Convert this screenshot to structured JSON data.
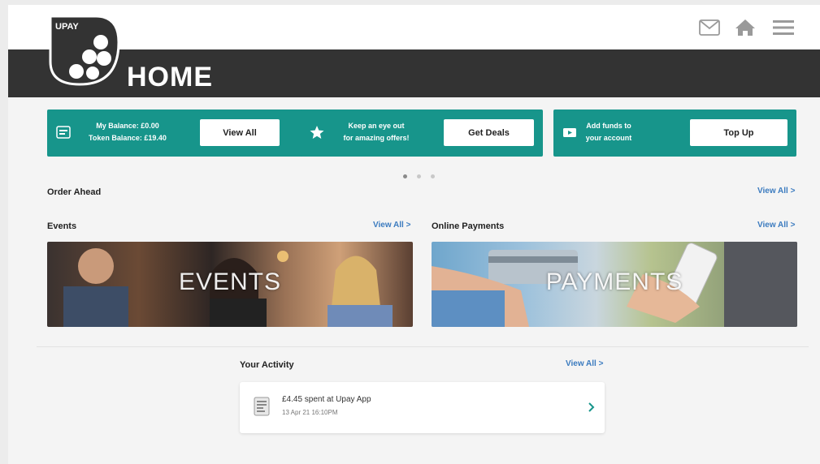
{
  "header": {
    "logo_text": "UPAY",
    "title": "HOME",
    "icons": [
      "mail-icon",
      "home-icon",
      "menu-icon"
    ]
  },
  "banners": [
    {
      "icon": "wallet-icon",
      "lines": [
        "My Balance: £0.00",
        "Token Balance: £19.40"
      ],
      "button": "View All"
    },
    {
      "icon": "star-icon",
      "lines": [
        "Keep an eye out",
        "for amazing offers!"
      ],
      "button": "Get Deals"
    },
    {
      "icon": "card-icon",
      "lines": [
        "Add funds to",
        "your account"
      ],
      "button": "Top Up"
    }
  ],
  "carousel": {
    "count": 3,
    "active_index": 0
  },
  "order_ahead": {
    "title": "Order Ahead",
    "view_all": "View All >"
  },
  "events": {
    "title": "Events",
    "view_all": "View All >",
    "image_label": "EVENTS"
  },
  "online_payments": {
    "title": "Online Payments",
    "view_all": "View All >",
    "image_label": "PAYMENTS"
  },
  "activity": {
    "title": "Your Activity",
    "view_all": "View All >",
    "items": [
      {
        "text": "£4.45 spent at Upay App",
        "date": "13 Apr 21 16:10PM",
        "icon": "receipt-icon"
      }
    ]
  },
  "colors": {
    "accent": "#17958b",
    "dark_band": "#333333",
    "link": "#3b7bbf"
  }
}
